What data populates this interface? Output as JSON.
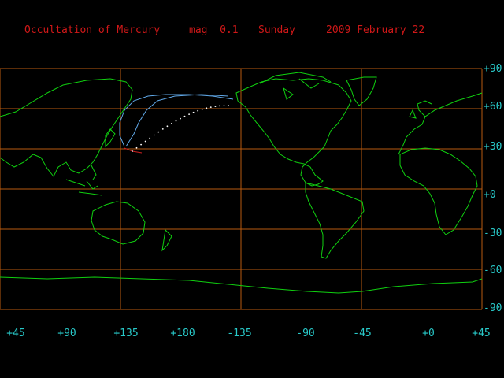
{
  "title": {
    "object": "Occultation of Mercury",
    "magnitude": "mag  0.1",
    "weekday": "Sunday",
    "date": "2009 February 22"
  },
  "grid": {
    "lat_labels": [
      "+90",
      "+60",
      "+30",
      "+0",
      "-30",
      "-60",
      "-90"
    ],
    "lon_labels": [
      "+45",
      "+90",
      "+135",
      "+180",
      "-135",
      "-90",
      "-45",
      "+0",
      "+45"
    ]
  },
  "colors": {
    "background": "#000000",
    "title": "#d01818",
    "grid": "#b85a10",
    "coastline": "#10d010",
    "labels": "#28c8c8",
    "visibility_curve": "#60a8e8",
    "contact_point": "#d02020",
    "occultation_track": "#ffffff"
  }
}
